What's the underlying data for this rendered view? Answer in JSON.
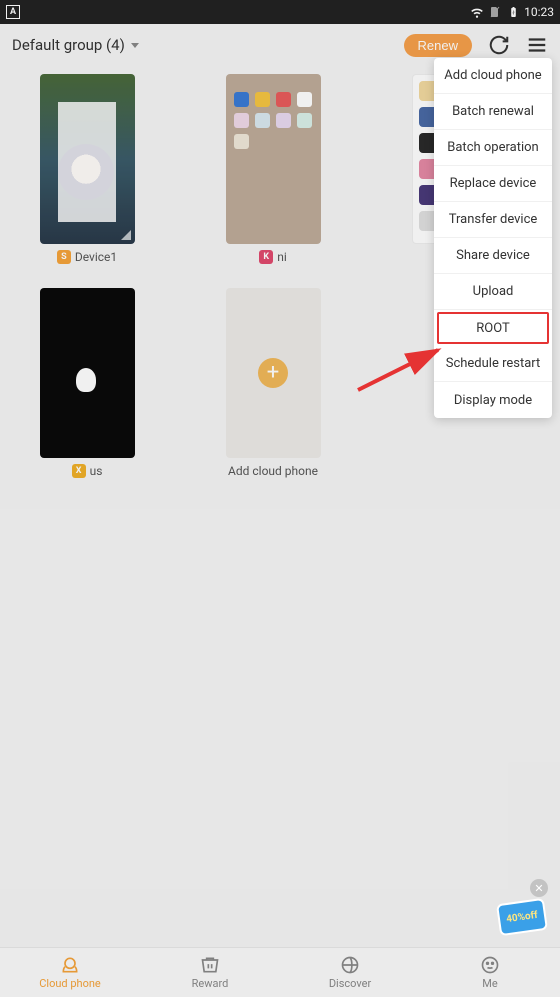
{
  "status_bar": {
    "app_indicator": "A",
    "time": "10:23"
  },
  "header": {
    "group_label": "Default group (4)",
    "renew_label": "Renew"
  },
  "devices": [
    {
      "badge": "S",
      "badge_class": "b-s",
      "name": "Device1"
    },
    {
      "badge": "K",
      "badge_class": "b-k",
      "name": "ni"
    },
    {
      "badge": "X",
      "badge_class": "b-x",
      "name": "us"
    }
  ],
  "add_card_label": "Add cloud phone",
  "menu": {
    "items": [
      "Add cloud phone",
      "Batch renewal",
      "Batch operation",
      "Replace device",
      "Transfer device",
      "Share device",
      "Upload",
      "ROOT",
      "Schedule restart",
      "Display mode"
    ],
    "highlight_index": 7
  },
  "nav": {
    "items": [
      {
        "label": "Cloud phone",
        "active": true
      },
      {
        "label": "Reward",
        "active": false
      },
      {
        "label": "Discover",
        "active": false
      },
      {
        "label": "Me",
        "active": false
      }
    ]
  },
  "promo": {
    "text": "40%off"
  }
}
